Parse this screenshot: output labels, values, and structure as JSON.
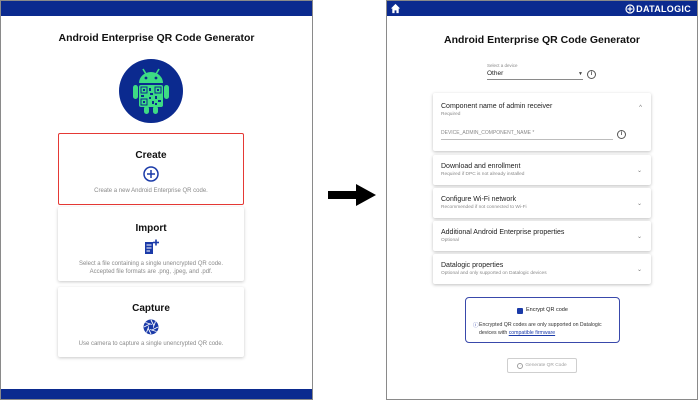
{
  "left_screen": {
    "title": "Android Enterprise QR Code Generator",
    "cards": [
      {
        "title": "Create",
        "icon": "add-circle-icon",
        "description": "Create a new Android Enterprise QR code.",
        "highlighted": true
      },
      {
        "title": "Import",
        "icon": "note-add-icon",
        "description": "Select a file containing a single unencrypted QR code.\nAccepted file formats are .png, .jpeg, and .pdf.",
        "highlighted": false
      },
      {
        "title": "Capture",
        "icon": "camera-shutter-icon",
        "description": "Use camera to capture a single unencrypted QR code.",
        "highlighted": false
      }
    ]
  },
  "right_screen": {
    "brand": "DATALOGIC",
    "title": "Android Enterprise QR Code Generator",
    "device_select": {
      "caption": "Select a device",
      "value": "Other"
    },
    "panels": [
      {
        "title": "Component name of admin receiver",
        "subtitle": "Required",
        "expanded": true,
        "field_placeholder": "DEVICE_ADMIN_COMPONENT_NAME *"
      },
      {
        "title": "Download and enrollment",
        "subtitle": "Required if DPC is not already installed",
        "expanded": false
      },
      {
        "title": "Configure Wi-Fi network",
        "subtitle": "Recommended if not connected to Wi-Fi",
        "expanded": false
      },
      {
        "title": "Additional Android Enterprise properties",
        "subtitle": "Optional",
        "expanded": false
      },
      {
        "title": "Datalogic properties",
        "subtitle": "Optional and only supported on Datalogic devices",
        "expanded": false
      }
    ],
    "encrypt": {
      "checkbox_label": "Encrypt QR code",
      "checked": true,
      "note_prefix": "Encrypted QR codes are only supported on Datalogic devices with ",
      "note_link": "compatible firmware"
    },
    "generate_button": "Generate QR Code"
  },
  "colors": {
    "brand_blue": "#0b2a8f",
    "android_green": "#3ddc84",
    "highlight_red": "#e53935",
    "link_blue": "#1a3aa8"
  }
}
